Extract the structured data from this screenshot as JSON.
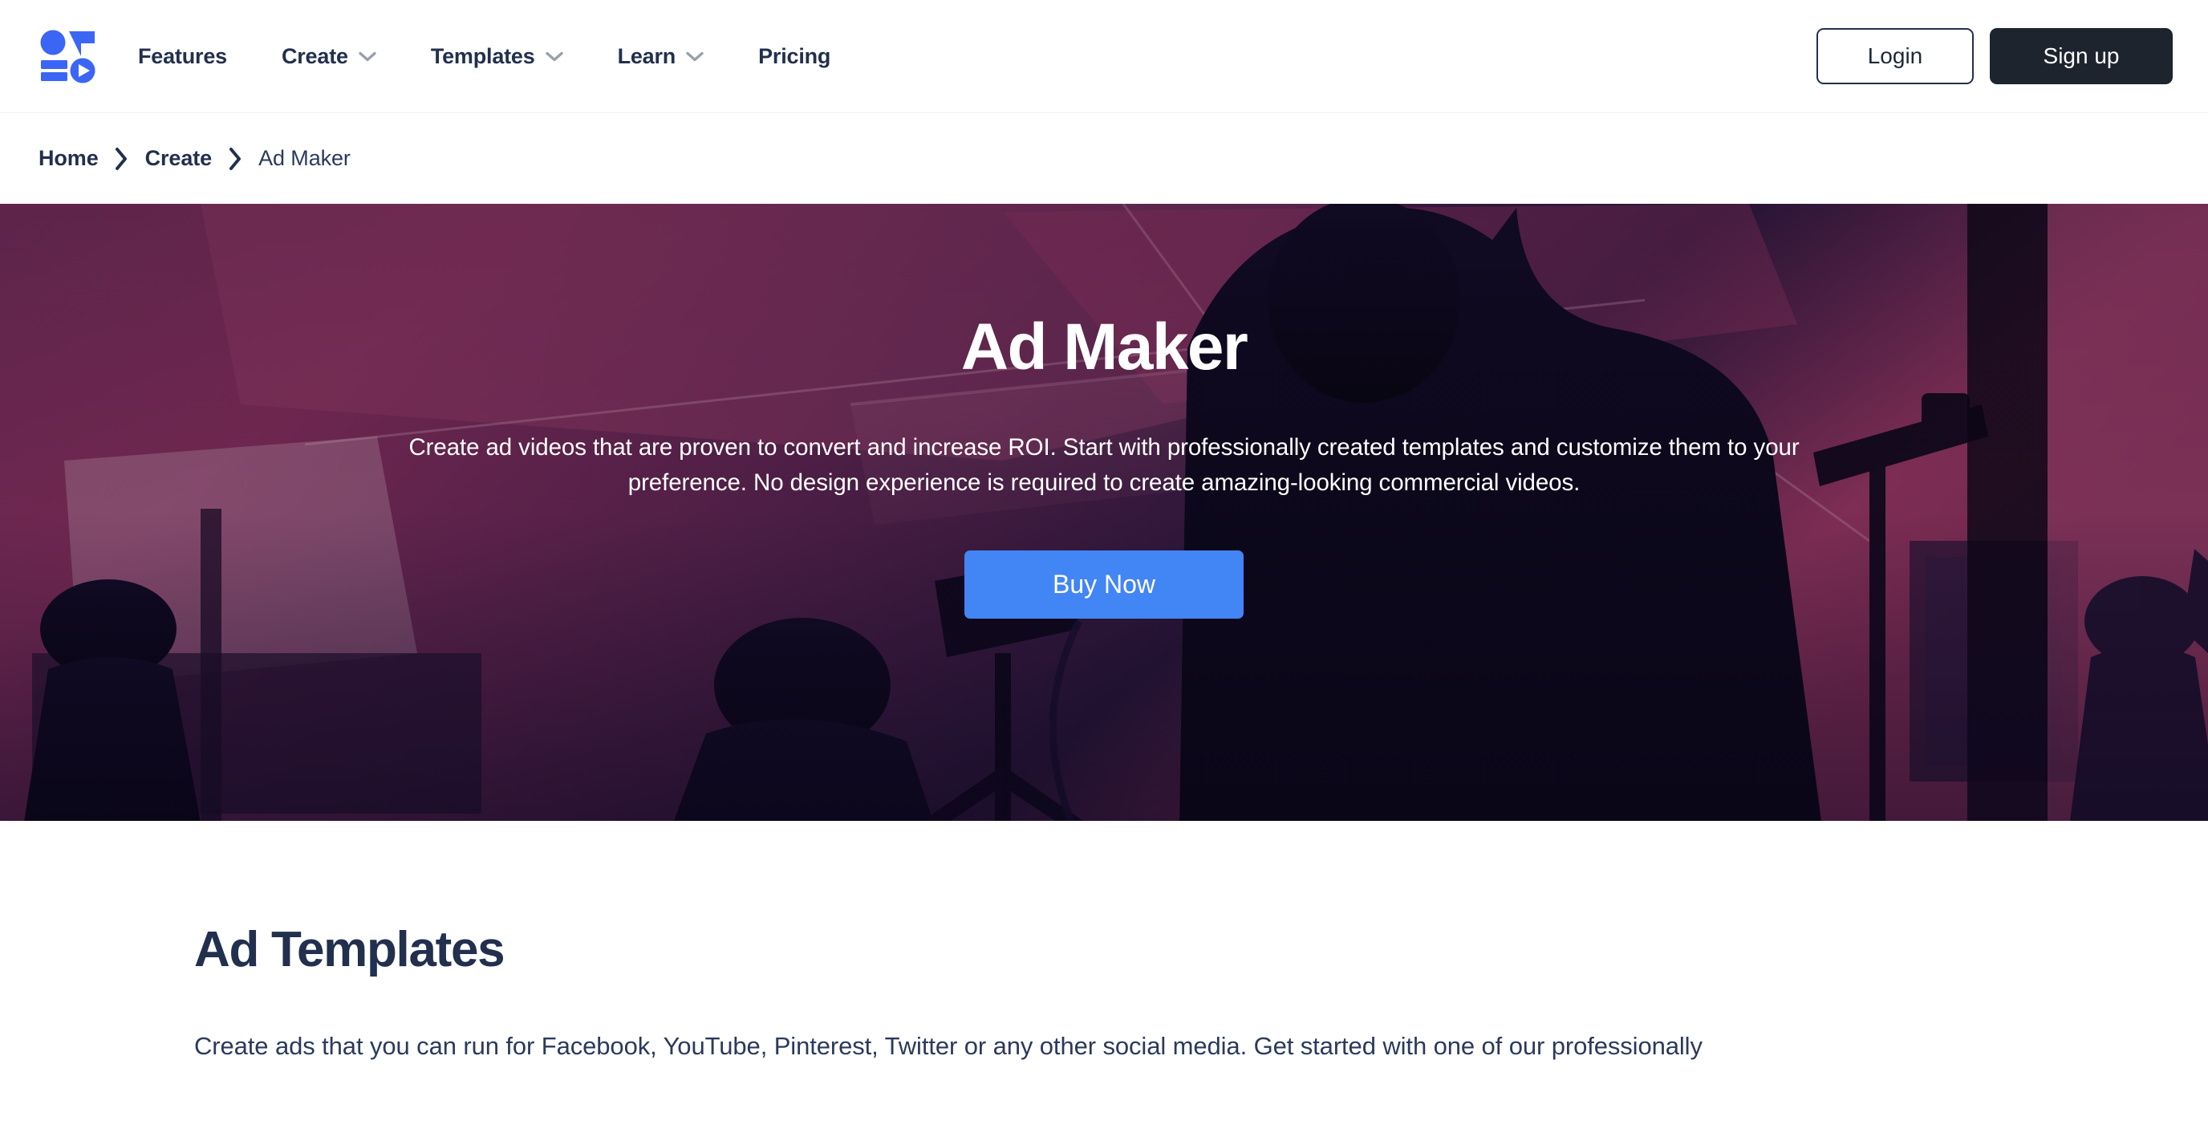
{
  "brand": {
    "logo_icon": "invideo-logo-icon",
    "accent_blue": "#4285f4",
    "navy": "#22304e",
    "dark": "#1e242e"
  },
  "header": {
    "nav": [
      {
        "label": "Features",
        "has_dropdown": false,
        "icon": ""
      },
      {
        "label": "Create",
        "has_dropdown": true,
        "icon": "chevron-down-icon"
      },
      {
        "label": "Templates",
        "has_dropdown": true,
        "icon": "chevron-down-icon"
      },
      {
        "label": "Learn",
        "has_dropdown": true,
        "icon": "chevron-down-icon"
      },
      {
        "label": "Pricing",
        "has_dropdown": false,
        "icon": ""
      }
    ],
    "login_label": "Login",
    "signup_label": "Sign up"
  },
  "breadcrumb": {
    "separator_icon": "chevron-right-icon",
    "items": [
      {
        "label": "Home",
        "current": false
      },
      {
        "label": "Create",
        "current": false
      },
      {
        "label": "Ad Maker",
        "current": true
      }
    ]
  },
  "hero": {
    "title": "Ad Maker",
    "subtitle": "Create ad videos that are proven to convert and increase ROI. Start with professionally created templates and customize them to your preference. No design experience is required to create amazing-looking commercial videos.",
    "cta_label": "Buy Now",
    "background_description": "film-set behind-the-scenes photo with magenta and purple duotone overlay"
  },
  "section": {
    "title": "Ad Templates",
    "body": "Create ads that you can run for Facebook, YouTube, Pinterest, Twitter or any other social media. Get started with one of our professionally"
  }
}
